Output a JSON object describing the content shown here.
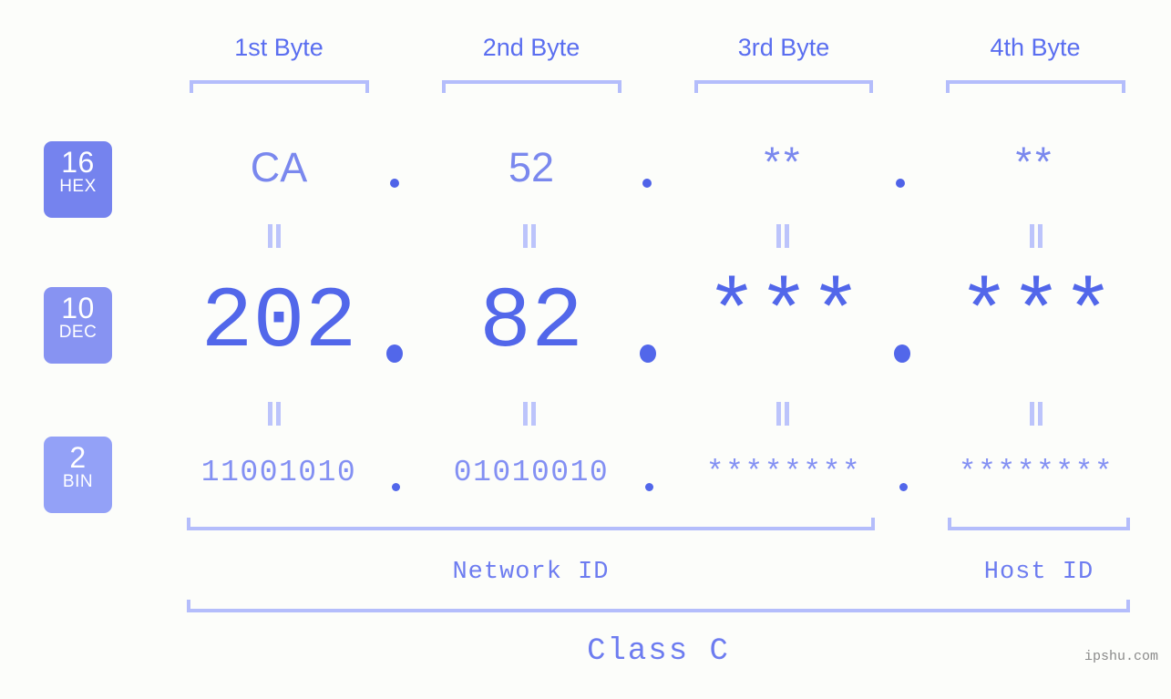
{
  "background_color": "#fcfdfa",
  "accent_color": "#5267ea",
  "accent_light": "#b4bdfb",
  "byte_headers": [
    {
      "label": "1st Byte"
    },
    {
      "label": "2nd Byte"
    },
    {
      "label": "3rd Byte"
    },
    {
      "label": "4th Byte"
    }
  ],
  "rows": [
    {
      "badge_number": "16",
      "badge_name": "HEX",
      "badge_color": "#7583ee",
      "values": [
        "CA",
        "52",
        "**",
        "**"
      ],
      "separators": [
        ".",
        ".",
        "."
      ]
    },
    {
      "badge_number": "10",
      "badge_name": "DEC",
      "badge_color": "#8793f2",
      "values": [
        "202",
        "82",
        "***",
        "***"
      ],
      "separators": [
        ".",
        ".",
        "."
      ]
    },
    {
      "badge_number": "2",
      "badge_name": "BIN",
      "badge_color": "#93a1f7",
      "values": [
        "11001010",
        "01010010",
        "********",
        "********"
      ],
      "separators": [
        ".",
        ".",
        "."
      ]
    }
  ],
  "equals_symbol": "||",
  "segments": {
    "network_id": "Network ID",
    "host_id": "Host ID",
    "class": "Class C"
  },
  "watermark": "ipshu.com",
  "ip_address": {
    "hex": "CA.52.**.**",
    "dec": "202.82.***.***",
    "bin": "11001010.01010010.********.********"
  }
}
